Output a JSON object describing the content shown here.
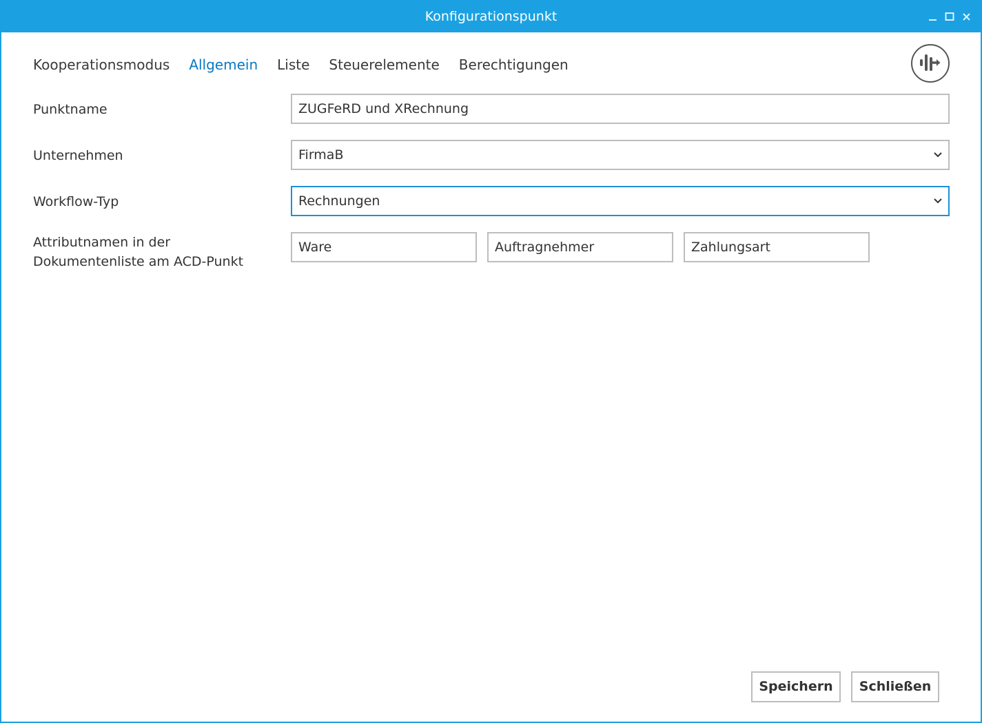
{
  "window": {
    "title": "Konfigurationspunkt",
    "accent": "#1ba1e2",
    "controls": [
      "minimize-icon",
      "maximize-icon",
      "close-icon"
    ]
  },
  "tabs": [
    {
      "label": "Kooperationsmodus",
      "active": false
    },
    {
      "label": "Allgemein",
      "active": true
    },
    {
      "label": "Liste",
      "active": false
    },
    {
      "label": "Steuerelemente",
      "active": false
    },
    {
      "label": "Berechtigungen",
      "active": false
    }
  ],
  "toolbar": {
    "logo_icon": "docuware-logo-icon"
  },
  "form": {
    "punktname": {
      "label": "Punktname",
      "value": "ZUGFeRD und XRechnung"
    },
    "unternehmen": {
      "label": "Unternehmen",
      "value": "FirmaB"
    },
    "workflow_typ": {
      "label": "Workflow-Typ",
      "value": "Rechnungen"
    },
    "attribute": {
      "label_line1": "Attributnamen in der",
      "label_line2": "Dokumentenliste am ACD-Punkt",
      "values": [
        "Ware",
        "Auftragnehmer",
        "Zahlungsart"
      ]
    }
  },
  "buttons": {
    "save_label": "Speichern",
    "close_label": "Schließen"
  }
}
